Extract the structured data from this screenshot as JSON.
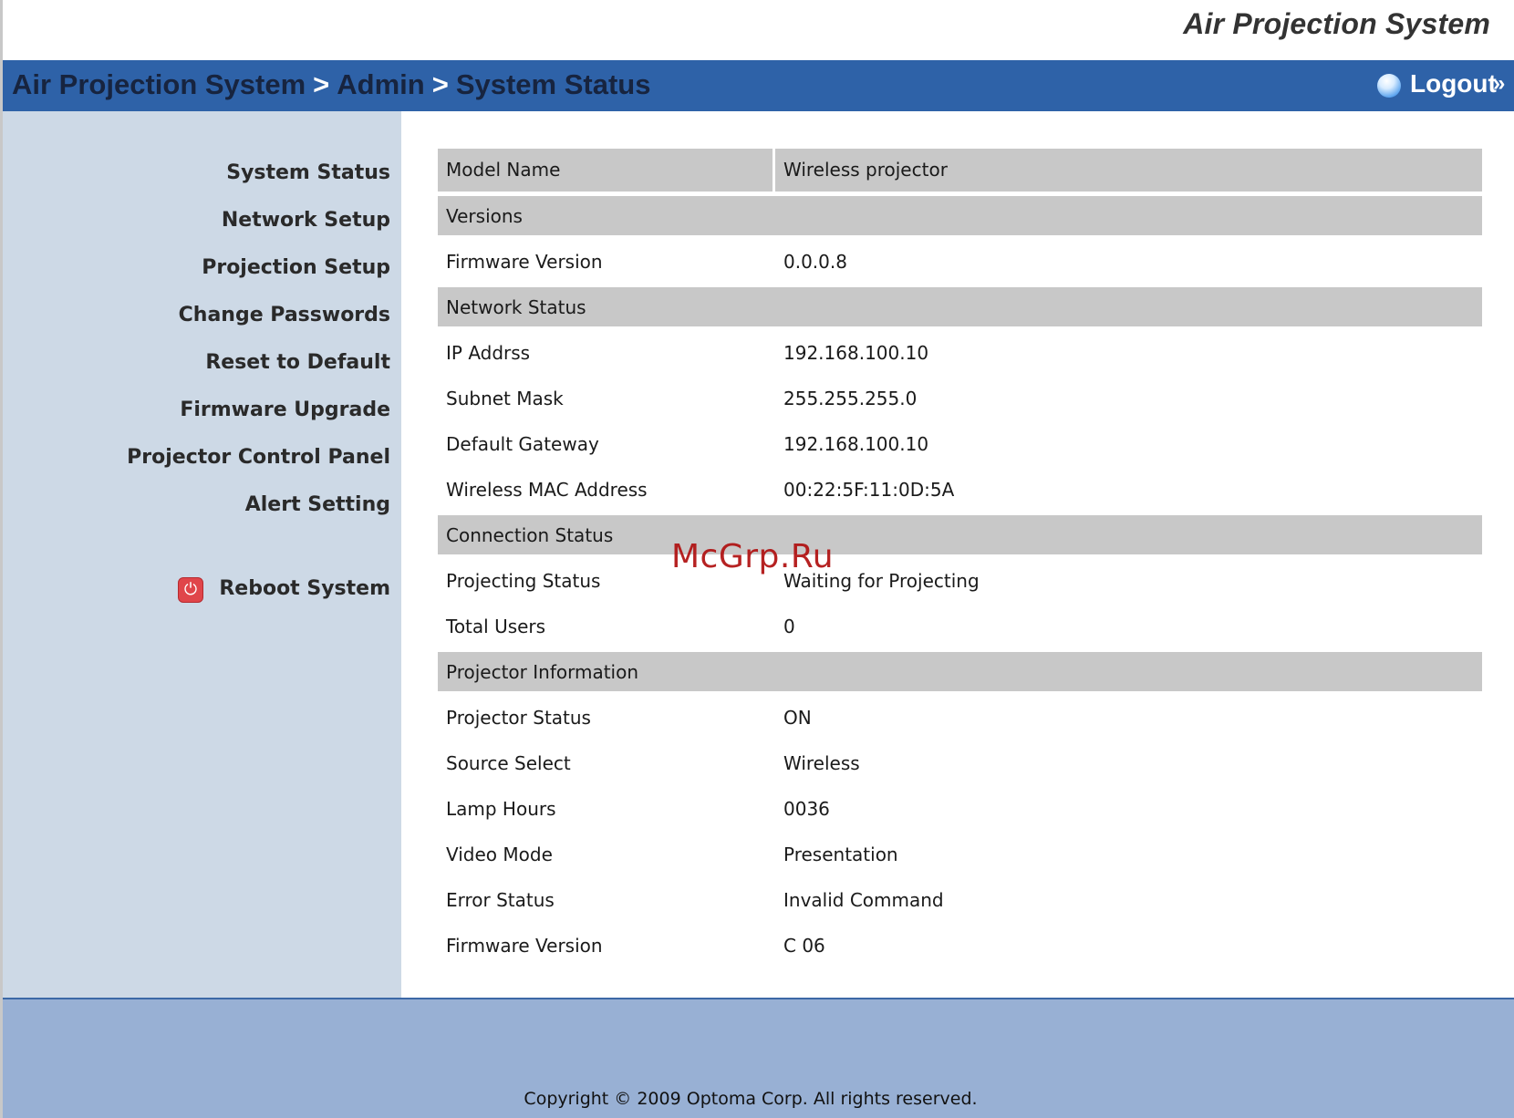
{
  "app": {
    "brand_title": "Air Projection System"
  },
  "header": {
    "breadcrumb": [
      "Air Projection System",
      "Admin",
      "System Status"
    ],
    "separator": ">",
    "logout_label": "Logout",
    "logout_chevron": "»",
    "logout_icon": "globe-icon"
  },
  "sidebar": {
    "items": [
      {
        "label": "System Status"
      },
      {
        "label": "Network Setup"
      },
      {
        "label": "Projection Setup"
      },
      {
        "label": "Change Passwords"
      },
      {
        "label": "Reset to Default"
      },
      {
        "label": "Firmware Upgrade"
      },
      {
        "label": "Projector Control Panel"
      },
      {
        "label": "Alert Setting"
      }
    ],
    "reboot_label": "Reboot System",
    "reboot_icon": "power-icon",
    "reboot_glyph": "⏻"
  },
  "status": {
    "model_name_label": "Model Name",
    "model_name_value": "Wireless projector",
    "sections": {
      "versions": "Versions",
      "network": "Network Status",
      "connection": "Connection Status",
      "projector": "Projector Information"
    },
    "rows": {
      "firmware_version": {
        "label": "Firmware Version",
        "value": "0.0.0.8"
      },
      "ip_address": {
        "label": "IP Addrss",
        "value": "192.168.100.10"
      },
      "subnet_mask": {
        "label": "Subnet Mask",
        "value": "255.255.255.0"
      },
      "default_gateway": {
        "label": "Default Gateway",
        "value": "192.168.100.10"
      },
      "wireless_mac": {
        "label": "Wireless MAC Address",
        "value": "00:22:5F:11:0D:5A"
      },
      "projecting_status": {
        "label": "Projecting Status",
        "value": "Waiting for Projecting"
      },
      "total_users": {
        "label": "Total Users",
        "value": "0"
      },
      "projector_status": {
        "label": "Projector Status",
        "value": "ON"
      },
      "source_select": {
        "label": "Source Select",
        "value": "Wireless"
      },
      "lamp_hours": {
        "label": "Lamp Hours",
        "value": "0036"
      },
      "video_mode": {
        "label": "Video Mode",
        "value": "Presentation"
      },
      "error_status": {
        "label": "Error Status",
        "value": "Invalid Command"
      },
      "projector_firmware": {
        "label": "Firmware Version",
        "value": "C 06"
      }
    }
  },
  "footer": {
    "copyright": "Copyright © 2009 Optoma Corp. All rights reserved."
  },
  "watermark": {
    "text": "McGrp.Ru"
  },
  "colors": {
    "header_bar": "#2e62a8",
    "sidebar": "#cdd9e6",
    "footer": "#98b0d4",
    "row_gray": "#c8c8c8"
  }
}
